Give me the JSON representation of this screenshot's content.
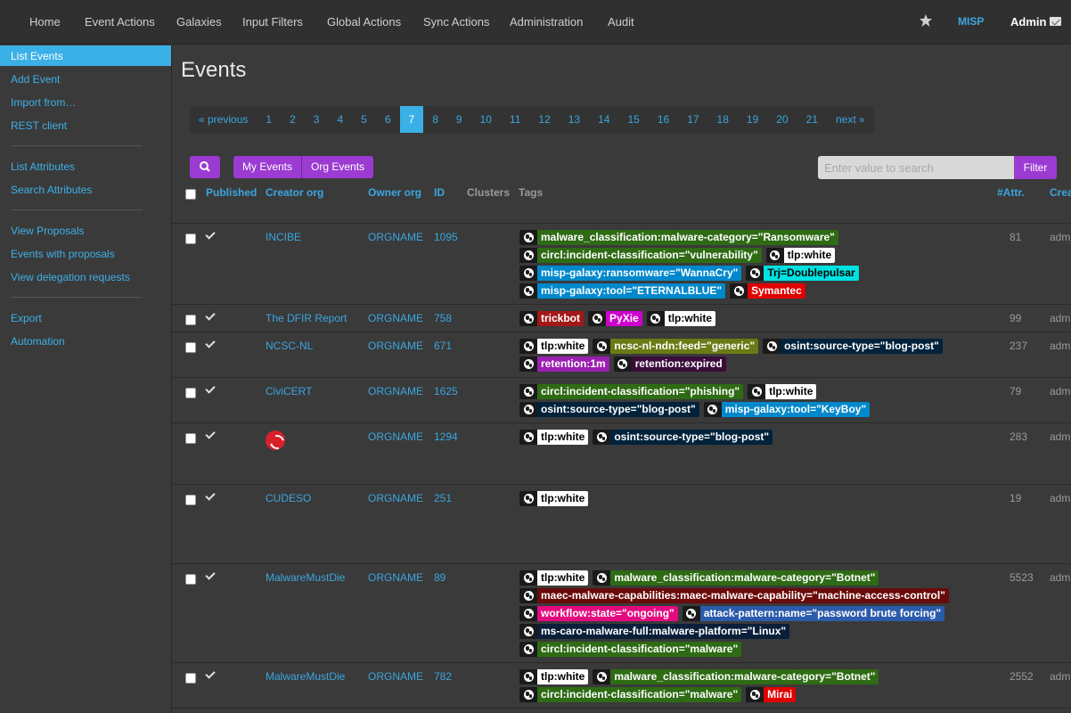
{
  "nav": {
    "items": [
      "Home",
      "Event Actions",
      "Galaxies",
      "Input Filters",
      "Global Actions",
      "Sync Actions",
      "Administration",
      "Audit"
    ],
    "brand": "MISP",
    "user": "Admin"
  },
  "sidebar": {
    "items": [
      "List Events",
      "Add Event",
      "Import from…",
      "REST client",
      "List Attributes",
      "Search Attributes",
      "View Proposals",
      "Events with proposals",
      "View delegation requests",
      "Export",
      "Automation"
    ],
    "active": "List Events"
  },
  "page": {
    "title": "Events",
    "pager": [
      "« previous",
      "1",
      "2",
      "3",
      "4",
      "5",
      "6",
      "7",
      "8",
      "9",
      "10",
      "11",
      "12",
      "13",
      "14",
      "15",
      "16",
      "17",
      "18",
      "19",
      "20",
      "21",
      "next »"
    ],
    "current_page": "7",
    "my_events": "My Events",
    "org_events": "Org Events",
    "search_placeholder": "Enter value to search",
    "filter": "Filter"
  },
  "table": {
    "headers": {
      "published": "Published",
      "creator": "Creator org",
      "owner": "Owner org",
      "id": "ID",
      "clusters": "Clusters",
      "tags": "Tags",
      "attr": "#Attr.",
      "creator_user": "Crea"
    },
    "rows": [
      {
        "creator": "INCIBE",
        "owner": "ORGNAME",
        "id": "1095",
        "attr": "81",
        "user": "adm",
        "tags": [
          [
            {
              "t": "malware_classification:malware-category=\"Ransomware\"",
              "bg": "#2e6b14",
              "fg": "#ffffff"
            }
          ],
          [
            {
              "t": "circl:incident-classification=\"vulnerability\"",
              "bg": "#2e6b14",
              "fg": "#ffffff"
            },
            {
              "t": "tlp:white",
              "bg": "#ffffff",
              "fg": "#000000"
            }
          ],
          [
            {
              "t": "misp-galaxy:ransomware=\"WannaCry\"",
              "bg": "#0088cc",
              "fg": "#ffffff"
            },
            {
              "t": "Trj=Doublepulsar",
              "bg": "#00e1e1",
              "fg": "#000000"
            }
          ],
          [
            {
              "t": "misp-galaxy:tool=\"ETERNALBLUE\"",
              "bg": "#0088cc",
              "fg": "#ffffff"
            },
            {
              "t": "Symantec",
              "bg": "#e00000",
              "fg": "#ffffff"
            }
          ]
        ]
      },
      {
        "creator": "The DFIR Report",
        "owner": "ORGNAME",
        "id": "758",
        "attr": "99",
        "user": "adm",
        "tags": [
          [
            {
              "t": "trickbot",
              "bg": "#a31818",
              "fg": "#ffffff"
            },
            {
              "t": "PyXie",
              "bg": "#cc00cc",
              "fg": "#ffffff"
            },
            {
              "t": "tlp:white",
              "bg": "#ffffff",
              "fg": "#000000"
            }
          ]
        ]
      },
      {
        "creator": "NCSC-NL",
        "owner": "ORGNAME",
        "id": "671",
        "attr": "237",
        "user": "adm",
        "tags": [
          [
            {
              "t": "tlp:white",
              "bg": "#ffffff",
              "fg": "#000000"
            },
            {
              "t": "ncsc-nl-ndn:feed=\"generic\"",
              "bg": "#6b7a14",
              "fg": "#ffffff"
            },
            {
              "t": "osint:source-type=\"blog-post\"",
              "bg": "#00223b",
              "fg": "#ffffff"
            }
          ],
          [
            {
              "t": "retention:1m",
              "bg": "#9b1fb0",
              "fg": "#ffffff"
            },
            {
              "t": "retention:expired",
              "bg": "#3a0d3a",
              "fg": "#ffffff"
            }
          ]
        ]
      },
      {
        "creator": "CiviCERT",
        "owner": "ORGNAME",
        "id": "1625",
        "attr": "79",
        "user": "adm",
        "tags": [
          [
            {
              "t": "circl:incident-classification=\"phishing\"",
              "bg": "#2e6b14",
              "fg": "#ffffff"
            },
            {
              "t": "tlp:white",
              "bg": "#ffffff",
              "fg": "#000000"
            }
          ],
          [
            {
              "t": "osint:source-type=\"blog-post\"",
              "bg": "#00223b",
              "fg": "#ffffff"
            },
            {
              "t": "misp-galaxy:tool=\"KeyBoy\"",
              "bg": "#0088cc",
              "fg": "#ffffff"
            }
          ]
        ]
      },
      {
        "creator": "",
        "owner": "ORGNAME",
        "id": "1294",
        "attr": "283",
        "user": "adm",
        "tags": [
          [
            {
              "t": "tlp:white",
              "bg": "#ffffff",
              "fg": "#000000"
            },
            {
              "t": "osint:source-type=\"blog-post\"",
              "bg": "#00223b",
              "fg": "#ffffff"
            }
          ]
        ]
      },
      {
        "creator": "CUDESO",
        "owner": "ORGNAME",
        "id": "251",
        "attr": "19",
        "user": "adm",
        "tags": [
          [
            {
              "t": "tlp:white",
              "bg": "#ffffff",
              "fg": "#000000"
            }
          ]
        ]
      },
      {
        "creator": "MalwareMustDie",
        "owner": "ORGNAME",
        "id": "89",
        "attr": "5523",
        "user": "adm",
        "tags": [
          [
            {
              "t": "tlp:white",
              "bg": "#ffffff",
              "fg": "#000000"
            },
            {
              "t": "malware_classification:malware-category=\"Botnet\"",
              "bg": "#2e6b14",
              "fg": "#ffffff"
            }
          ],
          [
            {
              "t": "maec-malware-capabilities:maec-malware-capability=\"machine-access-control\"",
              "bg": "#6b0a0a",
              "fg": "#ffffff"
            }
          ],
          [
            {
              "t": "workflow:state=\"ongoing\"",
              "bg": "#e30a7f",
              "fg": "#ffffff"
            },
            {
              "t": "attack-pattern:name=\"password brute forcing\"",
              "bg": "#2b5bab",
              "fg": "#ffffff"
            }
          ],
          [
            {
              "t": "ms-caro-malware-full:malware-platform=\"Linux\"",
              "bg": "#0a1f3a",
              "fg": "#ffffff"
            }
          ],
          [
            {
              "t": "circl:incident-classification=\"malware\"",
              "bg": "#2e6b14",
              "fg": "#ffffff"
            }
          ]
        ]
      },
      {
        "creator": "MalwareMustDie",
        "owner": "ORGNAME",
        "id": "782",
        "attr": "2552",
        "user": "adm",
        "tags": [
          [
            {
              "t": "tlp:white",
              "bg": "#ffffff",
              "fg": "#000000"
            },
            {
              "t": "malware_classification:malware-category=\"Botnet\"",
              "bg": "#2e6b14",
              "fg": "#ffffff"
            }
          ],
          [
            {
              "t": "circl:incident-classification=\"malware\"",
              "bg": "#2e6b14",
              "fg": "#ffffff"
            },
            {
              "t": "Mirai",
              "bg": "#e00000",
              "fg": "#ffffff"
            }
          ]
        ]
      }
    ]
  }
}
